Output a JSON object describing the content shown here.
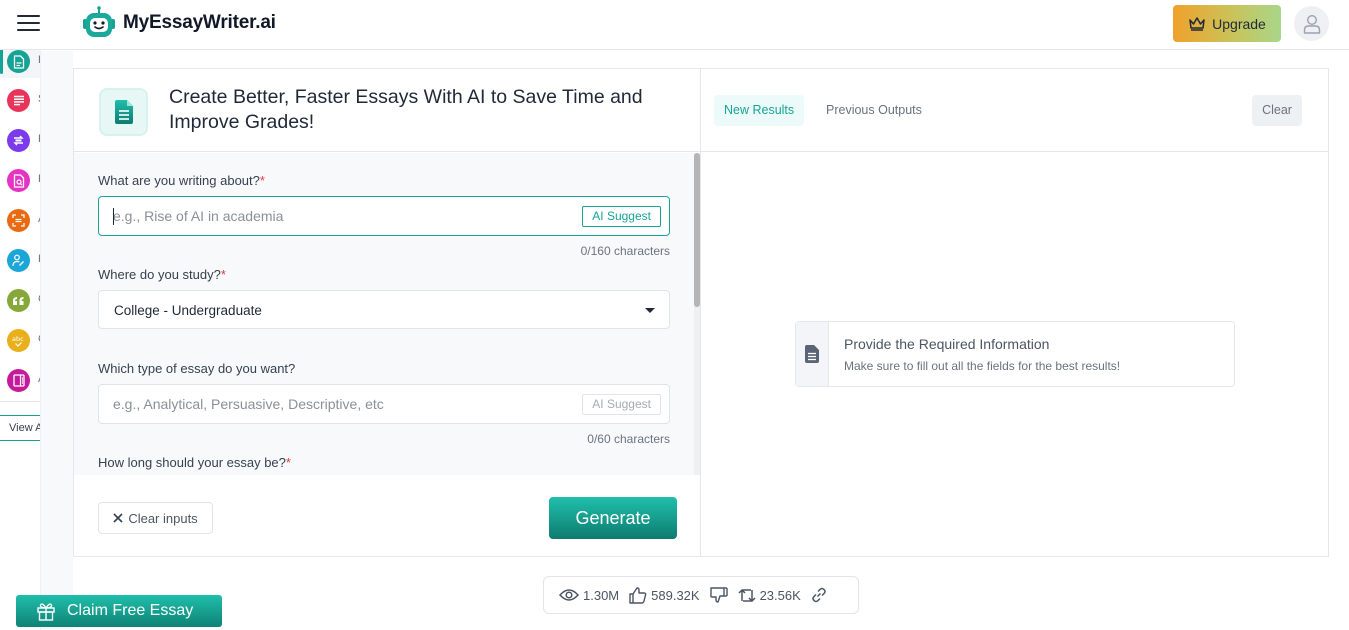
{
  "header": {
    "brand": "MyEssayWriter.ai",
    "upgrade_label": "Upgrade",
    "accent": "#14a394"
  },
  "sidebar": {
    "items": [
      {
        "icon": "document-icon",
        "color": "#14a394",
        "label": "E",
        "active": true
      },
      {
        "icon": "text-lines-icon",
        "color": "#e8345a",
        "label": "S",
        "active": false
      },
      {
        "icon": "rephrase-icon",
        "color": "#7c3aed",
        "label": "P",
        "active": false
      },
      {
        "icon": "document-search-icon",
        "color": "#e533c4",
        "label": "P",
        "active": false
      },
      {
        "icon": "scan-text-icon",
        "color": "#ea6a12",
        "label": "A",
        "active": false
      },
      {
        "icon": "user-edit-icon",
        "color": "#1ba6d8",
        "label": "H",
        "active": false
      },
      {
        "icon": "quote-icon",
        "color": "#86a83a",
        "label": "C",
        "active": false
      },
      {
        "icon": "spellcheck-icon",
        "color": "#e9b01c",
        "label": "G",
        "active": false
      },
      {
        "icon": "notebook-icon",
        "color": "#c41b9c",
        "label": "A",
        "active": false
      }
    ],
    "view_all_label": "View All"
  },
  "left_panel": {
    "title": "Create Better, Faster Essays With AI to Save Time and Improve Grades!",
    "fields": {
      "topic": {
        "label": "What are you writing about?",
        "required": "*",
        "placeholder": "e.g., Rise of AI in academia",
        "value": "",
        "ai_suggest": "AI Suggest",
        "counter": "0/160 characters"
      },
      "study": {
        "label": "Where do you study?",
        "required": "*",
        "selected": "College - Undergraduate"
      },
      "essay_type": {
        "label": "Which type of essay do you want?",
        "placeholder": "e.g., Analytical, Persuasive, Descriptive, etc",
        "value": "",
        "ai_suggest": "AI Suggest",
        "counter": "0/60 characters"
      },
      "length": {
        "label": "How long should your essay be?",
        "required": "*"
      }
    },
    "clear_inputs_label": "Clear inputs",
    "generate_label": "Generate",
    "scroll_position": 0
  },
  "right_panel": {
    "tabs": [
      {
        "label": "New Results",
        "active": true
      },
      {
        "label": "Previous Outputs",
        "active": false
      }
    ],
    "clear_label": "Clear",
    "info": {
      "title": "Provide the Required Information",
      "subtitle": "Make sure to fill out all the fields for the best results!"
    }
  },
  "stats": {
    "views": "1.30M",
    "likes": "589.32K",
    "shares": "23.56K"
  },
  "claim_label": "Claim Free Essay"
}
